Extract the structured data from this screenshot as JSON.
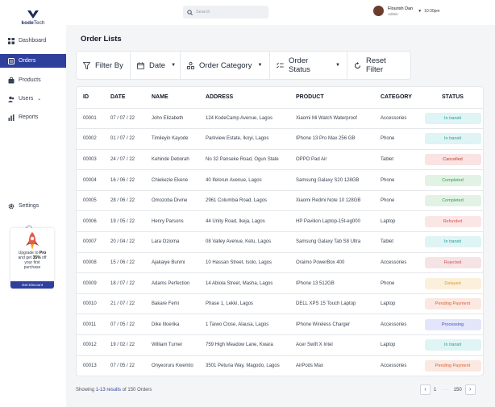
{
  "brand": {
    "name_bold": "kode",
    "name_rest": "Tech",
    "color": "#1e2a5a"
  },
  "sidebar": {
    "items": [
      {
        "label": "Dashboard",
        "icon": "dashboard-icon"
      },
      {
        "label": "Orders",
        "icon": "orders-icon",
        "active": true
      },
      {
        "label": "Products",
        "icon": "products-icon"
      },
      {
        "label": "Users",
        "icon": "users-icon",
        "chevron": "⌄"
      },
      {
        "label": "Reports",
        "icon": "reports-icon"
      }
    ],
    "settings_label": "Settings",
    "promo": {
      "line1_pre": "Upgrade to ",
      "line1_bold": "Pro",
      "line2_pre": "and get ",
      "line2_bold": "35%",
      "line2_post": " off",
      "line3": "your first",
      "line4": "purchase",
      "button": "Get Discount"
    }
  },
  "topbar": {
    "search_placeholder": "Search",
    "user_name": "Flourish Dan",
    "user_role": "Admin",
    "time": "10:30pm"
  },
  "page": {
    "title": "Order Lists"
  },
  "filters": {
    "filter_by": "Filter By",
    "date": "Date",
    "category": "Order Category",
    "status": "Order Status",
    "reset": "Reset Filter"
  },
  "table": {
    "headers": [
      "ID",
      "DATE",
      "NAME",
      "ADDRESS",
      "PRODUCT",
      "CATEGORY",
      "STATUS"
    ],
    "rows": [
      [
        "00001",
        "07 / 07 / 22",
        "John Elizabeth",
        "124 KodeCamp Avenue, Lagos",
        "Xiaomi Mi Watch Waterproof",
        "Accessories",
        "In transit"
      ],
      [
        "00002",
        "01 / 07 / 22",
        "Timileyin Kayode",
        "Parkview Estate, Ikoyi, Lagos",
        "IPhone 13 Pro Max 256 GB",
        "Phone",
        "In transit"
      ],
      [
        "00003",
        "24 / 07 / 22",
        "Kehinde Deborah",
        "No 32 Panseke Road, Ogun State",
        "OPPO Pad Air",
        "Tablet",
        "Cancelled"
      ],
      [
        "00004",
        "16 / 06 / 22",
        "Chiekezie Ekene",
        "40 Ifelorun Avenue, Lagos",
        "Samsung Galaxy S20 128GB",
        "Phone",
        "Completed"
      ],
      [
        "00005",
        "28 / 06 / 22",
        "Omozoba Divine",
        "2961 Columbia Road, Lagos",
        "Xiaomi Redmi Note 10 128GB",
        "Phone",
        "Completed"
      ],
      [
        "00006",
        "19 / 05 / 22",
        "Henry Parsons",
        "44 Unity Road, Ikeja, Lagos",
        "HP Pavilion Laptop-15t-eg000",
        "Laptop",
        "Refunded"
      ],
      [
        "00007",
        "20 / 04 / 22",
        "Lara Ozioma",
        "08 Valley Avenue, Ketu,  Lagos",
        "Samsung Galaxy Tab S8 Ultra",
        "Tablet",
        "In transit"
      ],
      [
        "00008",
        "15 / 06 / 22",
        "Ajakaiye Bunmi",
        "10 Hassan Street, Isolo, Lagos",
        "Oraimo PowerBox 400",
        "Accessories",
        "Rejected"
      ],
      [
        "00009",
        "18 / 07 / 22",
        "Adams Perfection",
        "14 Abiola Street, Masha, Lagos",
        "IPhone 13 512GB",
        "Phone",
        "Delayed"
      ],
      [
        "00010",
        "21 / 07 / 22",
        "Bakare Femi",
        "Phase 1, Lekki,  Lagos",
        "DELL XPS 15 Touch Laptop",
        "Laptop",
        "Pending Payment"
      ],
      [
        "00011",
        "07 / 05 / 22",
        "Dike Illoerika",
        "1 Taiwo Close, Alausa, Lagos",
        "IPhone Wireless Charger",
        "Accessories",
        "Processing"
      ],
      [
        "00012",
        "19 / 02 / 22",
        "William Turner",
        "759 High Meadow Lane,  Kwara",
        "Acer Swift X Intel",
        "Laptop",
        "In transit"
      ],
      [
        "00013",
        "07 / 05 / 22",
        "Onyeoruru Kwemto",
        "3501 Petuna Way, Magodo, Lagos",
        "AirPods Max",
        "Accessories",
        "Pending Payment"
      ]
    ],
    "status_colors": {
      "In transit": {
        "bg": "#dff4f4",
        "fg": "#1f9e9a"
      },
      "Cancelled": {
        "bg": "#f9e3e3",
        "fg": "#c0392b"
      },
      "Completed": {
        "bg": "#e2f3e6",
        "fg": "#2e9e4f"
      },
      "Refunded": {
        "bg": "#fbe6e6",
        "fg": "#d9534f"
      },
      "Rejected": {
        "bg": "#f6e3e6",
        "fg": "#d9534f"
      },
      "Delayed": {
        "bg": "#fbf0dc",
        "fg": "#d99a2b"
      },
      "Pending Payment": {
        "bg": "#fbe8e0",
        "fg": "#d9603b"
      },
      "Processing": {
        "bg": "#e3e6fb",
        "fg": "#3f4fbf"
      }
    }
  },
  "footer": {
    "showing_pre": "Showing ",
    "range": "1-13",
    "results_word": "results",
    "showing_post": " of 150 Orders",
    "page_first": "1",
    "page_dots": "· · ·",
    "page_last": "150",
    "prev": "‹",
    "next": "›"
  }
}
